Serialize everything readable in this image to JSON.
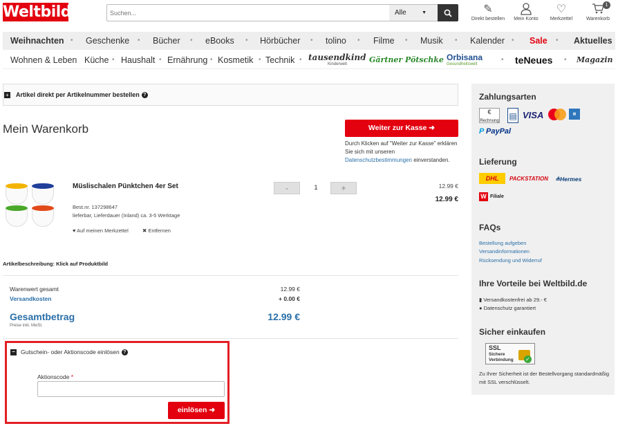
{
  "header": {
    "logo": "Weltbild",
    "search_placeholder": "Suchen...",
    "category": "Alle",
    "icons": [
      {
        "label": "Direkt bestellen",
        "icon": "order-icon"
      },
      {
        "label": "Mein Konto",
        "icon": "user-icon"
      },
      {
        "label": "Merkzettel",
        "icon": "heart-icon"
      },
      {
        "label": "Warenkorb",
        "icon": "cart-icon"
      }
    ],
    "cart_count": "1"
  },
  "nav1": [
    "Weihnachten",
    "Geschenke",
    "Bücher",
    "eBooks",
    "Hörbücher",
    "tolino",
    "Filme",
    "Musik",
    "Kalender",
    "Sale",
    "Aktuelles"
  ],
  "nav2": [
    "Wohnen & Leben",
    "Küche",
    "Haushalt",
    "Ernährung",
    "Kosmetik",
    "Technik",
    "tausendkind",
    "Gärtner Pötschke",
    "Orbisana",
    "teNeues",
    "Magazin"
  ],
  "nav2_sub": {
    "tausendkind": "Kinderwelt",
    "orbisana": "Gesundheitswelt"
  },
  "direct_order": {
    "label": "Artikel direkt per Artikelnummer bestellen",
    "help": "?"
  },
  "cart": {
    "title": "Mein Warenkorb",
    "checkout_label": "Weiter zur Kasse",
    "checkout_note_1": "Durch Klicken auf \"Weiter zur Kasse\" erklären Sie sich mit unseren",
    "checkout_note_link": "Datenschutzbestimmungen",
    "checkout_note_2": "einverstanden."
  },
  "item": {
    "name": "Müslischalen Pünktchen 4er Set",
    "order_no": "Best.nr. 137298647",
    "delivery": "lieferbar, Lieferdauer (Inland) ca. 3-5 Werktage",
    "wishlist": "Auf meinen Merkzettel",
    "remove": "Entfernen",
    "quantity": "1",
    "minus": "-",
    "plus": "+",
    "unit_price": "12.99 €",
    "total_price": "12.99 €"
  },
  "description_note": "Artikelbeschreibung: Klick auf Produktbild",
  "summary": {
    "goods_label": "Warenwert gesamt",
    "goods_value": "12.99 €",
    "shipping_label": "Versandkosten",
    "shipping_value": "+ 0.00 €",
    "total_label": "Gesamtbetrag",
    "total_value": "12.99 €",
    "vat_note": "Preise inkl. MwSt."
  },
  "coupon": {
    "label": "Gutschein- oder Aktionscode einlösen",
    "help": "?",
    "field_label": "Aktionscode",
    "required": "*",
    "button": "einlösen",
    "value": ""
  },
  "sidebar": {
    "payment_title": "Zahlungsarten",
    "payment_methods": [
      "Rechnung",
      "VISA",
      "PayPal"
    ],
    "delivery_title": "Lieferung",
    "delivery_methods": [
      "DHL",
      "PACKSTATION",
      "Hermes",
      "Filiale"
    ],
    "faq_title": "FAQs",
    "faq_links": [
      "Bestellung aufgeben",
      "Versandinformationen",
      "Rücksendung und Widerruf"
    ],
    "advantages_title": "Ihre Vorteile bei Weltbild.de",
    "advantages": [
      "Versandkostenfrei ab 29.- €",
      "Datenschutz garantiert"
    ],
    "secure_title": "Sicher einkaufen",
    "ssl_badge": [
      "SSL",
      "Sichere",
      "Verbindung"
    ],
    "secure_note": "Zu Ihrer Sicherheit ist der Bestellvorgang standardmäßig mit SSL verschlüsselt."
  },
  "colors": {
    "brand": "#e3000f",
    "link": "#2a6fa8",
    "highlight_border": "#e31e24"
  }
}
